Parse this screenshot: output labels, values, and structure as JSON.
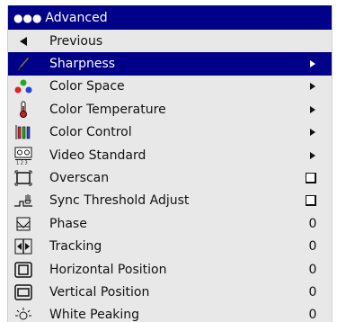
{
  "menu": {
    "title": "Advanced",
    "items": [
      {
        "label": "Previous",
        "icon": "previous-icon"
      },
      {
        "label": "Sharpness",
        "icon": "sharpness-icon",
        "control": "arrow",
        "selected": true
      },
      {
        "label": "Color Space",
        "icon": "color-space-icon",
        "control": "arrow"
      },
      {
        "label": "Color Temperature",
        "icon": "thermometer-icon",
        "control": "arrow"
      },
      {
        "label": "Color Control",
        "icon": "color-control-icon",
        "control": "arrow"
      },
      {
        "label": "Video Standard",
        "icon": "video-standard-icon",
        "control": "arrow"
      },
      {
        "label": "Overscan",
        "icon": "overscan-icon",
        "control": "checkbox"
      },
      {
        "label": "Sync Threshold Adjust",
        "icon": "sync-threshold-icon",
        "control": "checkbox"
      },
      {
        "label": "Phase",
        "icon": "phase-icon",
        "value": "0"
      },
      {
        "label": "Tracking",
        "icon": "tracking-icon",
        "value": "0"
      },
      {
        "label": "Horizontal Position",
        "icon": "horizontal-position-icon",
        "value": "0"
      },
      {
        "label": "Vertical Position",
        "icon": "vertical-position-icon",
        "value": "0"
      },
      {
        "label": "White Peaking",
        "icon": "white-peaking-icon",
        "value": "0"
      }
    ]
  },
  "colors": {
    "highlight": "#000088",
    "panel": "#e8e8e8"
  }
}
